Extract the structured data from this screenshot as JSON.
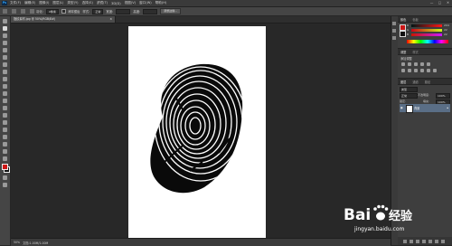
{
  "app": {
    "logo": "Ps",
    "menu": [
      "文件(F)",
      "编辑(E)",
      "图像(I)",
      "图层(L)",
      "类型(Y)",
      "选择(S)",
      "滤镜(T)",
      "3D(D)",
      "视图(V)",
      "窗口(W)",
      "帮助(H)"
    ],
    "window_controls": [
      "—",
      "□",
      "✕"
    ]
  },
  "options_bar": {
    "feather_label": "羽化:",
    "feather_value": "0像素",
    "antialias_label": "消除锯齿",
    "style_label": "样式:",
    "style_value": "正常",
    "width_label": "宽度:",
    "height_label": "高度:",
    "refine_button": "调整边缘..."
  },
  "document": {
    "tab_title": "指纹素材.jpg @ 50%(RGB/8#)",
    "tab_close": "×",
    "status_zoom": "50%",
    "status_doc": "文档:1.00M/1.00M"
  },
  "color_panel": {
    "tabs": [
      "颜色",
      "色板"
    ],
    "fg_color": "#cc1616",
    "bg_color": "#111111",
    "channels": [
      {
        "label": "R",
        "value": "204",
        "gradient": "linear-gradient(90deg,#001616,#ff1616)"
      },
      {
        "label": "G",
        "value": "22",
        "gradient": "linear-gradient(90deg,#cc0016,#ccff16)"
      },
      {
        "label": "B",
        "value": "22",
        "gradient": "linear-gradient(90deg,#cc1600,#cc16ff)"
      }
    ]
  },
  "adjustments_panel": {
    "tabs": [
      "调整",
      "样式"
    ],
    "subtitle": "添加调整"
  },
  "layers_panel": {
    "tabs": [
      "图层",
      "通道",
      "路径"
    ],
    "kind_filter": "类型",
    "blend_mode": "正常",
    "opacity_label": "不透明度:",
    "opacity_value": "100%",
    "lock_label": "锁定:",
    "fill_label": "填充:",
    "fill_value": "100%",
    "layers": [
      {
        "name": "背景",
        "visible": true,
        "locked": true
      }
    ]
  },
  "watermark": {
    "brand": "Bai",
    "brand_suffix": "经验",
    "url": "jingyan.baidu.com"
  }
}
